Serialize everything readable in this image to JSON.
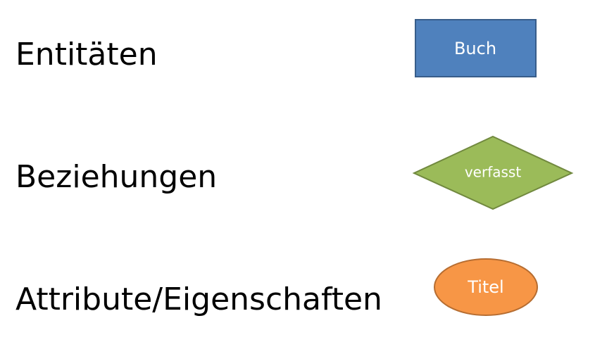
{
  "legend": [
    {
      "label": "Entitäten",
      "shape": "rectangle",
      "example": "Buch",
      "fill": "#4f81bd",
      "stroke": "#385d8a"
    },
    {
      "label": "Beziehungen",
      "shape": "diamond",
      "example": "verfasst",
      "fill": "#9bbb59",
      "stroke": "#71893f"
    },
    {
      "label": "Attribute/Eigenschaften",
      "shape": "ellipse",
      "example": "Titel",
      "fill": "#f79646",
      "stroke": "#b66d31"
    }
  ]
}
